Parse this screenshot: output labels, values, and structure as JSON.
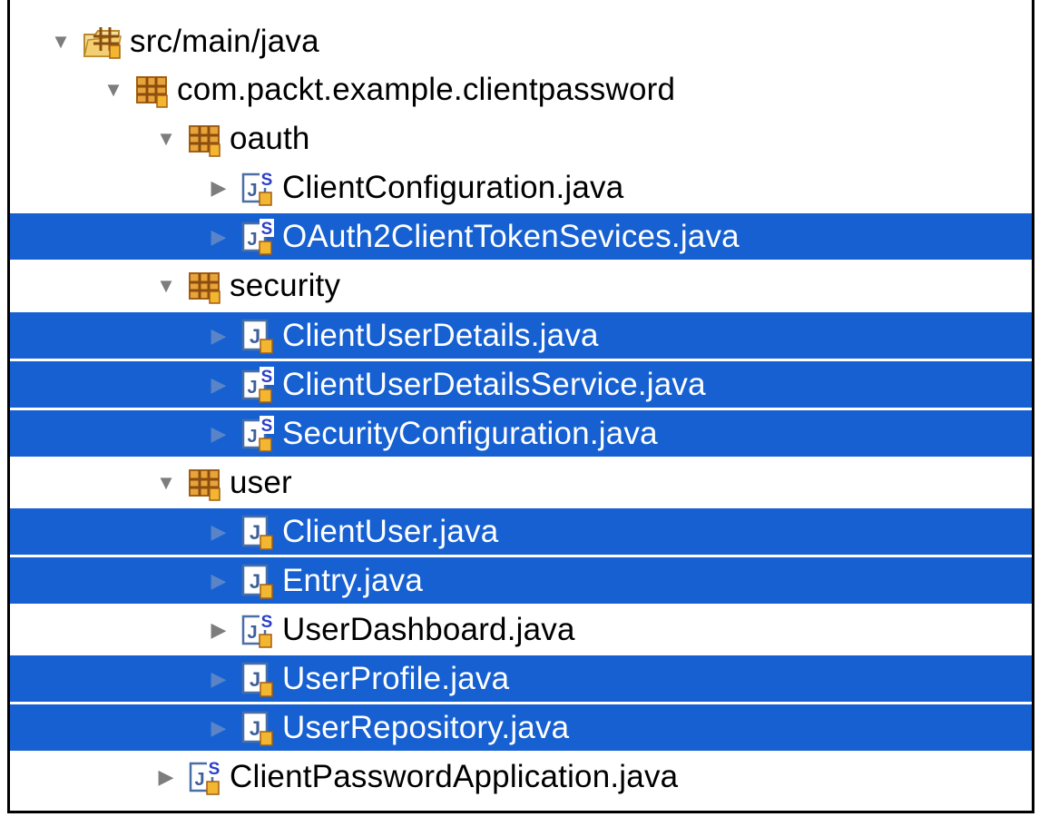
{
  "tree": [
    {
      "label": "src/main/java",
      "kind": "source-folder",
      "expanded": true,
      "depth": 0,
      "selected": false
    },
    {
      "label": "com.packt.example.clientpassword",
      "kind": "package",
      "expanded": true,
      "depth": 1,
      "selected": false
    },
    {
      "label": "oauth",
      "kind": "package",
      "expanded": true,
      "depth": 2,
      "selected": false
    },
    {
      "label": "ClientConfiguration.java",
      "kind": "spring-java-file",
      "expanded": false,
      "depth": 3,
      "selected": false
    },
    {
      "label": "OAuth2ClientTokenSevices.java",
      "kind": "spring-java-file",
      "expanded": false,
      "depth": 3,
      "selected": true
    },
    {
      "label": "security",
      "kind": "package",
      "expanded": true,
      "depth": 2,
      "selected": false
    },
    {
      "label": "ClientUserDetails.java",
      "kind": "java-file",
      "expanded": false,
      "depth": 3,
      "selected": true
    },
    {
      "label": "ClientUserDetailsService.java",
      "kind": "spring-java-file",
      "expanded": false,
      "depth": 3,
      "selected": true
    },
    {
      "label": "SecurityConfiguration.java",
      "kind": "spring-java-file",
      "expanded": false,
      "depth": 3,
      "selected": true
    },
    {
      "label": "user",
      "kind": "package",
      "expanded": true,
      "depth": 2,
      "selected": false
    },
    {
      "label": "ClientUser.java",
      "kind": "java-file",
      "expanded": false,
      "depth": 3,
      "selected": true
    },
    {
      "label": "Entry.java",
      "kind": "java-file",
      "expanded": false,
      "depth": 3,
      "selected": true
    },
    {
      "label": "UserDashboard.java",
      "kind": "spring-java-file",
      "expanded": false,
      "depth": 3,
      "selected": false
    },
    {
      "label": "UserProfile.java",
      "kind": "java-file",
      "expanded": false,
      "depth": 3,
      "selected": true
    },
    {
      "label": "UserRepository.java",
      "kind": "java-file",
      "expanded": false,
      "depth": 3,
      "selected": true
    },
    {
      "label": "ClientPasswordApplication.java",
      "kind": "spring-java-file",
      "expanded": false,
      "depth": 2,
      "selected": false
    }
  ],
  "colors": {
    "selection": "#1660d2",
    "package_orange": "#d88a1a",
    "package_brown": "#a25e12",
    "java_blue": "#4a6fa5",
    "spring_badge": "#2b3fc9",
    "twisty_gray": "#7d7d7d"
  },
  "icons": {
    "source-folder": "source-folder-icon",
    "package": "package-icon",
    "java-file": "java-file-icon",
    "spring-java-file": "spring-java-file-icon"
  }
}
